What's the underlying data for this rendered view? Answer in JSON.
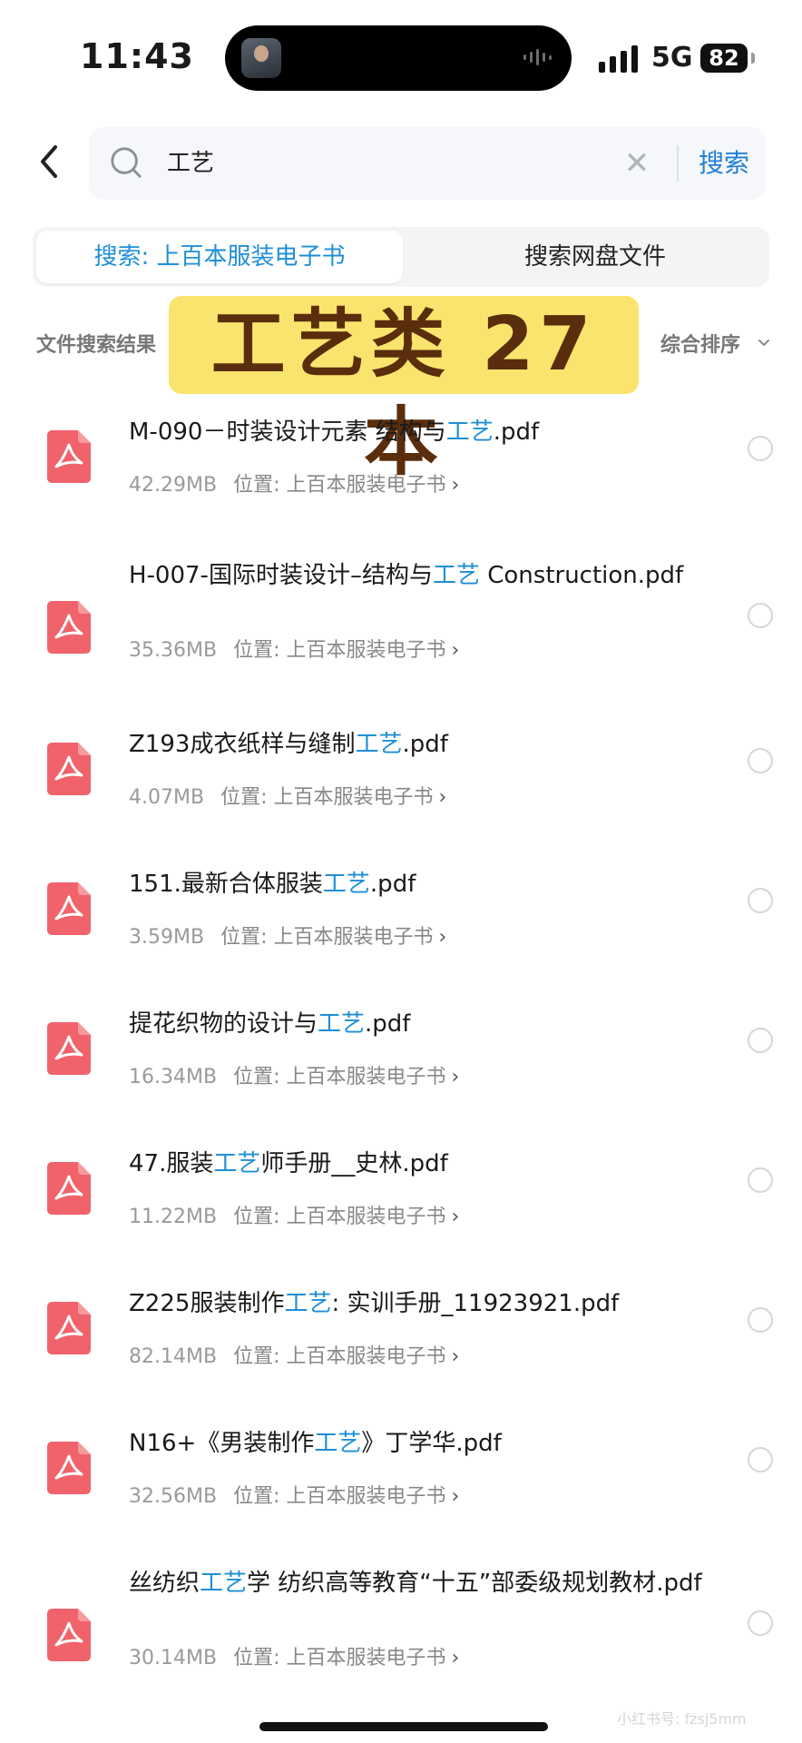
{
  "status_bar": {
    "time": "11:43",
    "network": "5G",
    "battery": "82"
  },
  "header": {
    "search_value": "工艺",
    "search_button": "搜索",
    "back_icon": "chevron-left-icon",
    "search_icon": "magnifier-icon",
    "clear_icon": "close-icon"
  },
  "tabs": [
    {
      "label": "搜索: 上百本服装电子书",
      "active": true
    },
    {
      "label": "搜索网盘文件",
      "active": false
    }
  ],
  "results": {
    "label": "文件搜索结果",
    "sort_label": "综合排序",
    "overlay_banner": "工艺类 27 本"
  },
  "colors": {
    "accent": "#1f8fd6",
    "pdf_icon": "#f0636b",
    "banner_bg": "#fbe46d",
    "banner_text": "#5a2e0c"
  },
  "files": [
    {
      "name_before": "M-090－时装设计元素 结构与",
      "name_highlight": "工艺",
      "name_after": ".pdf",
      "size": "42.29MB",
      "location": "位置: 上百本服装电子书"
    },
    {
      "name_before": "H-007-国际时装设计–结构与",
      "name_highlight": "工艺",
      "name_after": " Construction.pdf",
      "size": "35.36MB",
      "location": "位置: 上百本服装电子书"
    },
    {
      "name_before": "Z193成衣纸样与缝制",
      "name_highlight": "工艺",
      "name_after": ".pdf",
      "size": "4.07MB",
      "location": "位置: 上百本服装电子书"
    },
    {
      "name_before": "151.最新合体服装",
      "name_highlight": "工艺",
      "name_after": ".pdf",
      "size": "3.59MB",
      "location": "位置: 上百本服装电子书"
    },
    {
      "name_before": "提花织物的设计与",
      "name_highlight": "工艺",
      "name_after": ".pdf",
      "size": "16.34MB",
      "location": "位置: 上百本服装电子书"
    },
    {
      "name_before": "47.服装",
      "name_highlight": "工艺",
      "name_after": "师手册__史林.pdf",
      "size": "11.22MB",
      "location": "位置: 上百本服装电子书"
    },
    {
      "name_before": "Z225服装制作",
      "name_highlight": "工艺",
      "name_after": ": 实训手册_11923921.pdf",
      "size": "82.14MB",
      "location": "位置: 上百本服装电子书"
    },
    {
      "name_before": "N16+《男装制作",
      "name_highlight": "工艺",
      "name_after": "》丁学华.pdf",
      "size": "32.56MB",
      "location": "位置: 上百本服装电子书"
    },
    {
      "name_before": "丝纺织",
      "name_highlight": "工艺",
      "name_after": "学 纺织高等教育“十五”部委级规划教材.pdf",
      "size": "30.14MB",
      "location": "位置: 上百本服装电子书"
    }
  ],
  "watermark": "小红书号: fzsj5mm"
}
